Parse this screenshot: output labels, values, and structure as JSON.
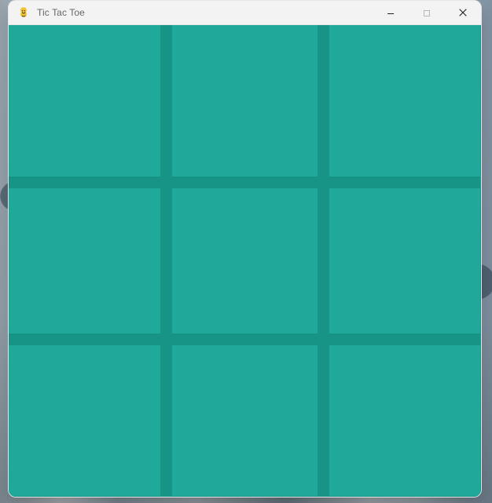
{
  "window": {
    "title": "Tic Tac Toe"
  },
  "colors": {
    "tile": "#1ea99b",
    "grid_line": "#179486"
  },
  "board": {
    "cells": [
      "",
      "",
      "",
      "",
      "",
      "",
      "",
      "",
      ""
    ]
  },
  "icons": {
    "app": "pygame-snake-icon",
    "minimize": "minimize-icon",
    "maximize": "maximize-icon",
    "close": "close-icon"
  }
}
